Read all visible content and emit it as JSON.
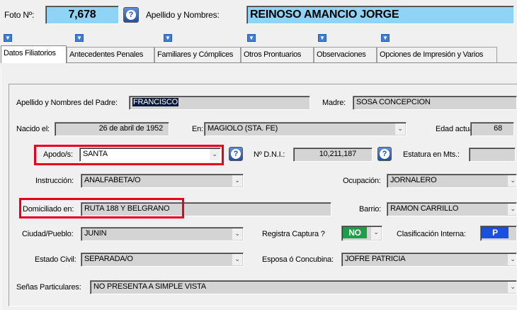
{
  "header": {
    "foto_label": "Foto Nº:",
    "foto_value": "7,678",
    "name_label": "Apellido y Nombres:",
    "name_value": "REINOSO AMANCIO JORGE"
  },
  "tabs": [
    {
      "label": "Datos Filiatorios",
      "active": true
    },
    {
      "label": "Antecedentes Penales"
    },
    {
      "label": "Familiares y Cómplices"
    },
    {
      "label": "Otros Prontuarios"
    },
    {
      "label": "Observaciones"
    },
    {
      "label": "Opciones de Impresión y Varios"
    }
  ],
  "form": {
    "padre_label": "Apellido y Nombres del Padre:",
    "padre_value": "FRANCISCO",
    "madre_label": "Madre:",
    "madre_value": "SOSA CONCEPCION",
    "nacido_label": "Nacido el:",
    "nacido_value": "26 de abril de 1952",
    "en_label": "En:",
    "en_value": "MAGIOLO (STA. FE)",
    "edad_label": "Edad actual:",
    "edad_value": "68",
    "apodo_label": "Apodo/s:",
    "apodo_value": "SANTA",
    "dni_label": "Nº D.N.I.:",
    "dni_value": "10,211,187",
    "estatura_label": "Estatura en Mts.:",
    "estatura_value": "",
    "instruccion_label": "Instrucción:",
    "instruccion_value": "ANALFABETA/O",
    "ocupacion_label": "Ocupación:",
    "ocupacion_value": "JORNALERO",
    "domicilio_label": "Domiciliado en:",
    "domicilio_value": "RUTA 188 Y BELGRANO",
    "barrio_label": "Barrio:",
    "barrio_value": "RAMON CARRILLO",
    "ciudad_label": "Ciudad/Pueblo:",
    "ciudad_value": "JUNIN",
    "captura_label": "Registra Captura ?",
    "captura_value": "NO",
    "clasif_label": "Clasificación Interna:",
    "clasif_value": "P",
    "civil_label": "Estado Civil:",
    "civil_value": "SEPARADA/O",
    "esposa_label": "Esposa ó Concubina:",
    "esposa_value": "JOFRE PATRICIA",
    "senas_label": "Señas Particulares:",
    "senas_value": "NO PRESENTA A SIMPLE VISTA"
  },
  "icons": {
    "help": "help-icon",
    "dropdown": "chevron-down-icon",
    "tab_arrow": "arrow-down-icon"
  },
  "colors": {
    "highlight": "#e8001c",
    "field_cyan": "#8fd3f7",
    "captura_green": "#1f9e4a",
    "clasif_blue": "#1a4fe0"
  }
}
